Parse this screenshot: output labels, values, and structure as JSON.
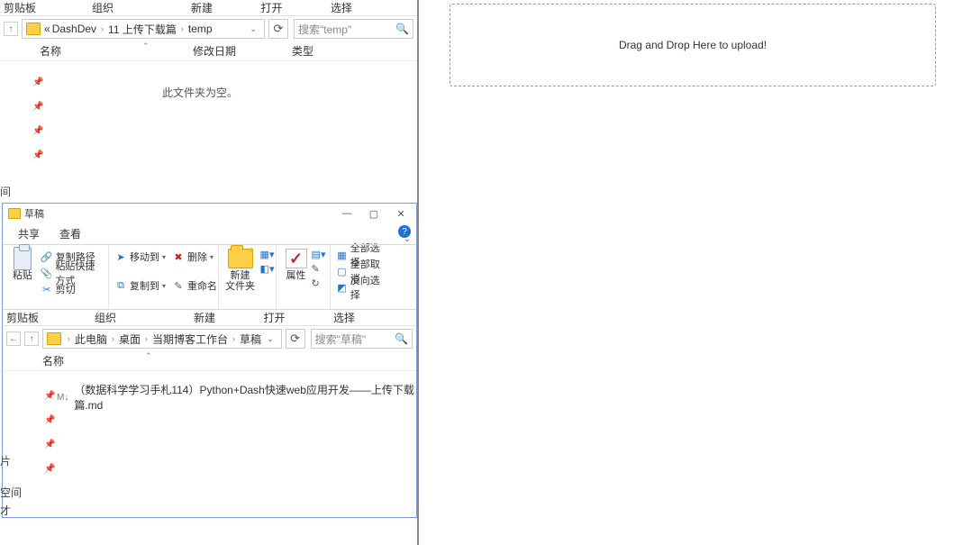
{
  "ribbon_sections": {
    "clipboard": "剪贴板",
    "organize": "组织",
    "new": "新建",
    "open": "打开",
    "select": "选择"
  },
  "explorer1": {
    "breadcrumb": {
      "ellipsis": "«",
      "seg1": "DashDev",
      "seg2": "11 上传下载篇",
      "seg3": "temp"
    },
    "search_placeholder": "搜索\"temp\"",
    "columns": {
      "name": "名称",
      "date": "修改日期",
      "type": "类型"
    },
    "empty": "此文件夹为空。",
    "sidebar_bottom": "间"
  },
  "explorer2": {
    "title": "草稿",
    "tabs": {
      "share": "共享",
      "view": "查看"
    },
    "ribbon": {
      "paste": "粘贴",
      "copy_path": "复制路径",
      "paste_shortcut": "粘贴快捷方式",
      "cut": "剪切",
      "move_to": "移动到",
      "copy_to": "复制到",
      "delete": "删除",
      "rename": "重命名",
      "new_folder": "新建\n文件夹",
      "properties": "属性",
      "select_all": "全部选择",
      "select_none": "全部取消",
      "invert": "反向选择"
    },
    "breadcrumb": {
      "seg1": "此电脑",
      "seg2": "桌面",
      "seg3": "当期博客工作台",
      "seg4": "草稿"
    },
    "search_placeholder": "搜索\"草稿\"",
    "columns": {
      "name": "名称"
    },
    "file1": "（数据科学学习手札114）Python+Dash快速web应用开发——上传下载篇.md",
    "sidebar_labels": {
      "pictures": "片",
      "space": "空间",
      "misc": "才"
    }
  },
  "dropzone_text": "Drag and Drop Here to upload!"
}
